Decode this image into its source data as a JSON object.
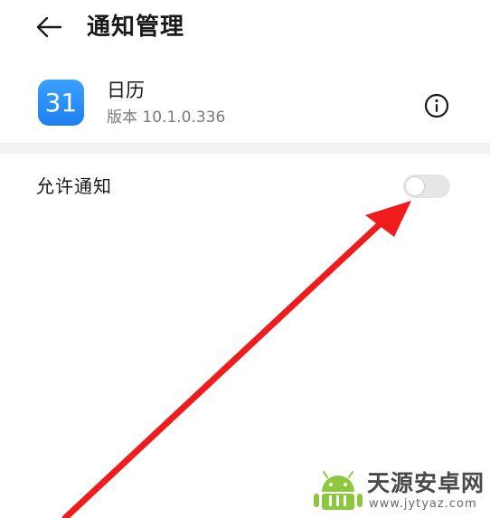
{
  "header": {
    "title": "通知管理",
    "back_icon": "arrow-left-icon"
  },
  "app": {
    "icon_text": "31",
    "name": "日历",
    "version": "版本 10.1.0.336",
    "icon_color": "#2a8cf5",
    "info_icon": "info-circle-icon"
  },
  "settings": {
    "allow_notifications": {
      "label": "允许通知",
      "enabled": false
    }
  },
  "annotation": {
    "arrow_color": "#ee1c1c"
  },
  "watermark": {
    "name": "天源安卓网",
    "url": "www.jytyaz.com"
  }
}
